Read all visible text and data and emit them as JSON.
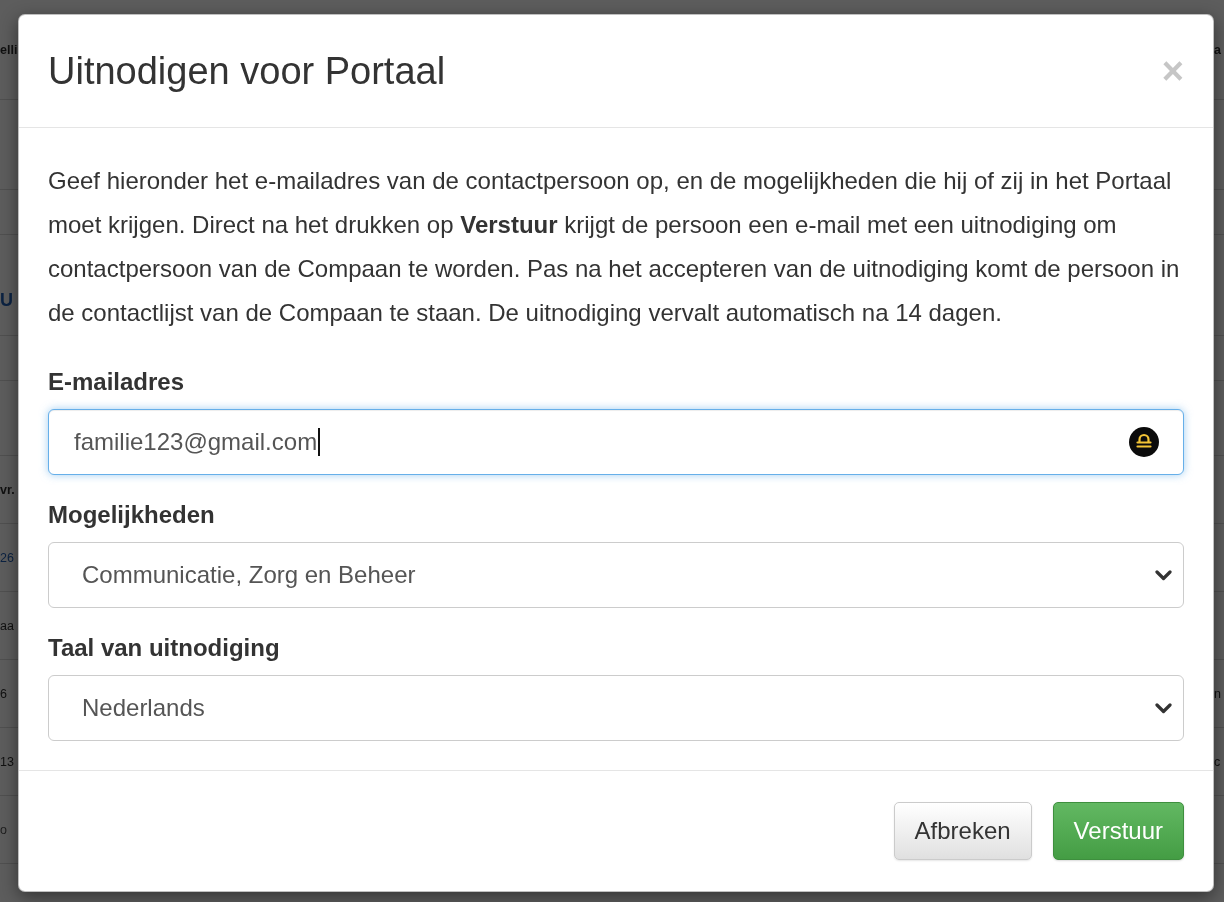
{
  "background_page": {
    "rows": [
      {
        "kind": "header",
        "left": {
          "text": "elli",
          "kind": "bold"
        },
        "right": {
          "text": "a",
          "kind": "bold"
        }
      },
      {
        "kind": "gap"
      },
      {
        "kind": "band"
      },
      {
        "kind": "title",
        "left": {
          "text": "U",
          "kind": "link"
        }
      },
      {
        "kind": "band"
      },
      {
        "kind": "filter"
      },
      {
        "kind": "row",
        "left": {
          "text": "vr.",
          "kind": "bold"
        }
      },
      {
        "kind": "row",
        "left": {
          "text": "26",
          "kind": "link"
        }
      },
      {
        "kind": "row",
        "left": {
          "text": "aa",
          "kind": "plain"
        }
      },
      {
        "kind": "row",
        "left": {
          "text": "6",
          "kind": "plain"
        },
        "right": {
          "text": "n",
          "kind": "plain"
        }
      },
      {
        "kind": "row",
        "left": {
          "text": "13",
          "kind": "plain"
        },
        "right": {
          "text": "c",
          "kind": "plain"
        }
      },
      {
        "kind": "row",
        "left": {
          "text": "o",
          "kind": "muted"
        }
      }
    ]
  },
  "dialog": {
    "title": "Uitnodigen voor Portaal",
    "close": "×",
    "intro": "Geef hieronder het e-mailadres van de contactpersoon op, en de mogelijkheden die hij of zij in het Portaal moet krijgen. Direct na het drukken op **Verstuur** krijgt de persoon een e-mail met een uitnodiging om contactpersoon van de Compaan te worden. Pas na het accepteren van de uitnodiging komt de persoon in de contactlijst van de Compaan te staan. De uitnodiging vervalt automatisch na 14 dagen.",
    "fields": [
      {
        "kind": "input",
        "label": "E-mailadres",
        "value": "familie123@gmail.com",
        "focused": true
      },
      {
        "kind": "select",
        "label": "Mogelijkheden",
        "value": "Communicatie, Zorg en Beheer",
        "focused": false
      },
      {
        "kind": "select",
        "label": "Taal van uitnodiging",
        "value": "Nederlands",
        "focused": false
      }
    ],
    "buttons": [
      {
        "kind": "cancel",
        "label": "Afbreken"
      },
      {
        "kind": "submit",
        "label": "Verstuur"
      }
    ]
  }
}
